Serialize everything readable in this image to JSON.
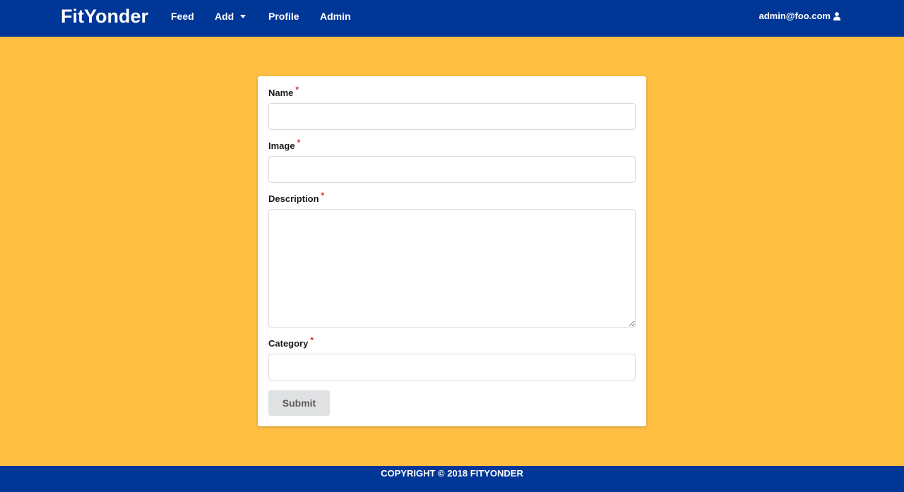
{
  "navbar": {
    "brand": "FitYonder",
    "items": [
      {
        "label": "Feed"
      },
      {
        "label": "Add"
      },
      {
        "label": "Profile"
      },
      {
        "label": "Admin"
      }
    ],
    "user_email": "admin@foo.com",
    "user_icon": "user-icon"
  },
  "form": {
    "required_marker": "*",
    "fields": [
      {
        "label": "Name",
        "value": ""
      },
      {
        "label": "Image",
        "value": ""
      },
      {
        "label": "Description",
        "value": ""
      },
      {
        "label": "Category",
        "value": ""
      }
    ],
    "submit_label": "Submit"
  },
  "footer": {
    "text": "COPYRIGHT © 2018 FITYONDER"
  },
  "colors": {
    "navbar_bg": "#003796",
    "page_bg": "#FFBF43",
    "required": "#db2828",
    "button_bg": "#e0e1e2"
  }
}
